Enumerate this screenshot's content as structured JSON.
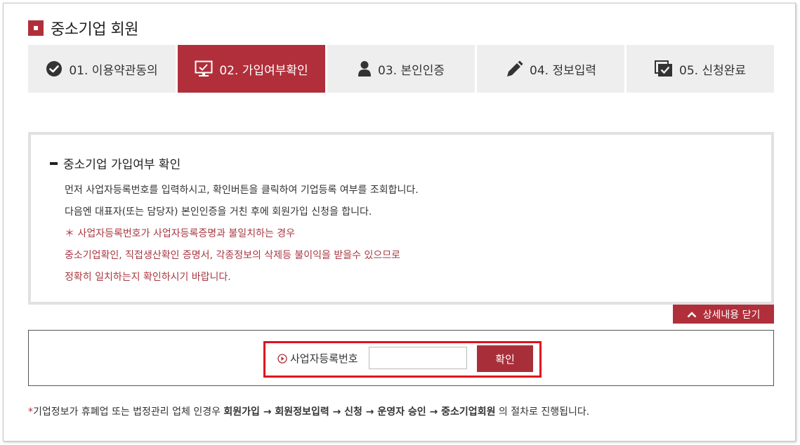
{
  "page": {
    "title": "중소기업 회원"
  },
  "steps": [
    {
      "label": "01. 이용약관동의",
      "icon": "check-circle-icon"
    },
    {
      "label": "02. 가입여부확인",
      "icon": "monitor-icon",
      "active": true
    },
    {
      "label": "03. 본인인증",
      "icon": "person-icon"
    },
    {
      "label": "04. 정보입력",
      "icon": "pencil-icon"
    },
    {
      "label": "05. 신청완료",
      "icon": "document-check-icon"
    }
  ],
  "info": {
    "heading": "중소기업 가입여부 확인",
    "lines": [
      "먼저 사업자등록번호를 입력하시고, 확인버튼을 클릭하여 기업등록 여부를 조회합니다.",
      "다음엔 대표자(또는 담당자) 본인인증을 거친 후에 회원가입 신청을 합니다.",
      "＊ 사업자등록번호가 사업자등록증명과 불일치하는 경우",
      "중소기업확인, 직접생산확인 증명서, 각종정보의 삭제등 불이익을 받을수 있으므로",
      "정확히 일치하는지 확인하시기 바랍니다."
    ]
  },
  "toggle": {
    "label": "상세내용 닫기"
  },
  "form": {
    "label": "사업자등록번호",
    "value": "",
    "button": "확인"
  },
  "note": {
    "star": "*",
    "prefix": "기업정보가 휴폐업 또는 법정관리 업체 인경우 ",
    "flow": "회원가입 → 회원정보입력 → 신청 → 운영자 승인 → 중소기업회원",
    "suffix": " 의 절차로 진행됩니다."
  },
  "colors": {
    "accent": "#b02f3a",
    "highlight": "#e0101e",
    "text_red": "#a83841"
  }
}
